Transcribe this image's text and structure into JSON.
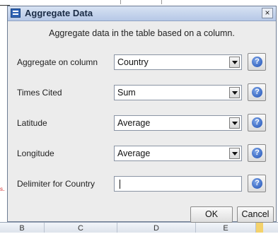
{
  "dialog": {
    "title": "Aggregate Data",
    "close_label": "×",
    "description": "Aggregate data in the table based on a column."
  },
  "rows": [
    {
      "label": "Aggregate on column",
      "type": "dropdown",
      "value": "Country"
    },
    {
      "label": "Times Cited",
      "type": "dropdown",
      "value": "Sum"
    },
    {
      "label": "Latitude",
      "type": "dropdown",
      "value": "Average"
    },
    {
      "label": "Longitude",
      "type": "dropdown",
      "value": "Average"
    },
    {
      "label": "Delimiter for Country",
      "type": "text",
      "value": ""
    }
  ],
  "help_glyph": "?",
  "icons": {
    "dialog": "table-icon",
    "help": "help-icon",
    "dropdown": "chevron-down-icon"
  },
  "buttons": {
    "ok": "OK",
    "cancel": "Cancel"
  },
  "background": {
    "red_mark": "s.",
    "column_headers": [
      "B",
      "C",
      "D",
      "E"
    ]
  }
}
